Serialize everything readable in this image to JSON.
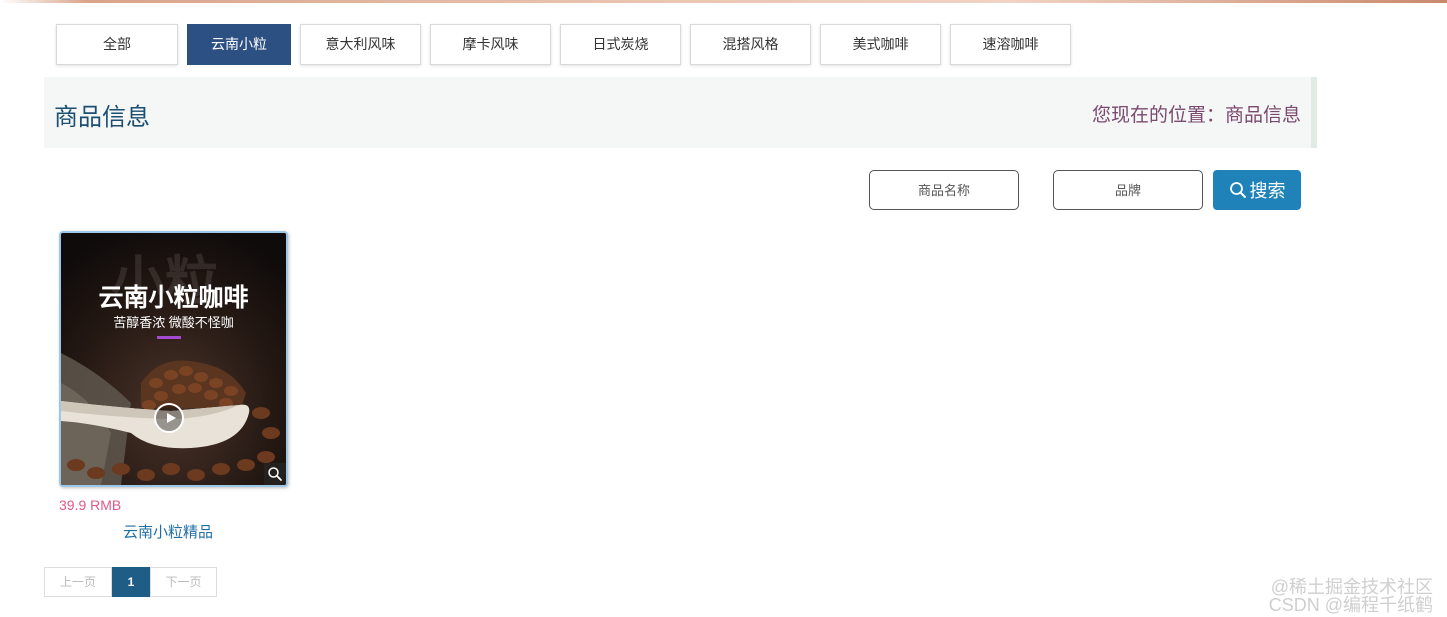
{
  "categories": {
    "items": [
      {
        "label": "全部"
      },
      {
        "label": "云南小粒",
        "active": true
      },
      {
        "label": "意大利风味"
      },
      {
        "label": "摩卡风味"
      },
      {
        "label": "日式炭烧"
      },
      {
        "label": "混搭风格"
      },
      {
        "label": "美式咖啡"
      },
      {
        "label": "速溶咖啡"
      }
    ]
  },
  "info_bar": {
    "title": "商品信息",
    "location": "您现在的位置：商品信息"
  },
  "search": {
    "name_placeholder": "商品名称",
    "brand_placeholder": "品牌",
    "button_label": "搜索"
  },
  "products": [
    {
      "image_big_char": "小粒",
      "image_title": "云南小粒咖啡",
      "image_subtitle": "苦醇香浓 微酸不怪咖",
      "price": "39.9 RMB",
      "name": "云南小粒精品"
    }
  ],
  "pagination": {
    "prev_label": "上一页",
    "current_page": "1",
    "next_label": "下一页"
  },
  "watermark": {
    "line1": "@稀土掘金技术社区",
    "line2": "CSDN @编程千纸鹤"
  },
  "colors": {
    "active_tab": "#2d5082",
    "search_button": "#1f82b8",
    "price": "#e0588a",
    "title": "#1b4f72",
    "location": "#7a4a6e"
  }
}
